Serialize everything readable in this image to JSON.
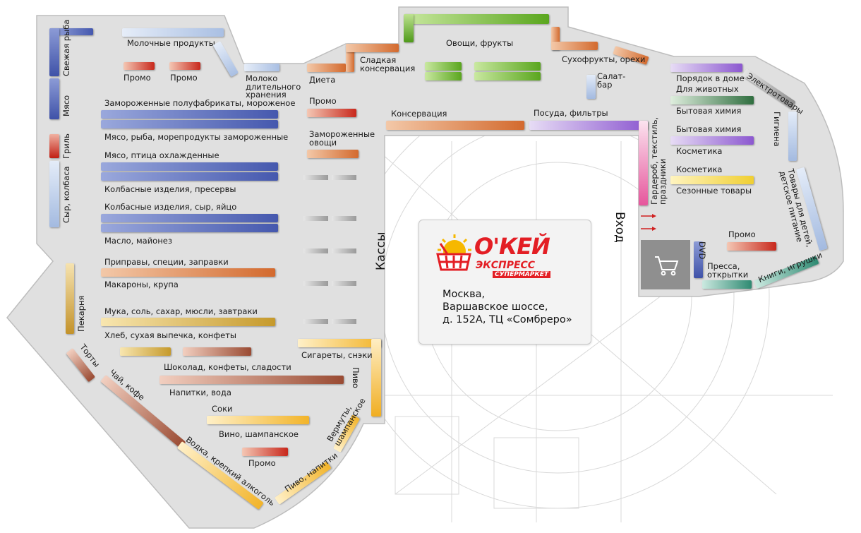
{
  "store": {
    "brand": "О'КЕЙ",
    "brand_sub": "ЭКСПРЕСС",
    "brand_sub2": "СУПЕРМАРКЕТ",
    "address_line1": "Москва,",
    "address_line2": "Варшавское шоссе,",
    "address_line3": "д. 152А, ТЦ «Сомбреро»"
  },
  "colors": {
    "floor": "#e2e2e2",
    "frozen_meat": "#4558ae",
    "bakery": "#c69a2c",
    "vegetables": "#5aa61e",
    "household": "#8c58d0",
    "alcohol": "#f2b42a",
    "promo": "#c8281c",
    "brand_red": "#e31e24",
    "brand_yellow": "#f6b800"
  },
  "zones": {
    "kassy": "Кассы",
    "vhod": "Вход"
  },
  "labels": {
    "svezhaya_ryba": "Свежая рыба",
    "myaso": "Мясо",
    "gril": "Гриль",
    "syr_kolbasa": "Сыр, колбаса",
    "molochnye": "Молочные продукты",
    "promo1": "Промо",
    "promo2": "Промо",
    "moloko": "Молоко длительного хранения",
    "zamor_polufabr": "Замороженные полуфабрикаты, мороженое",
    "myaso_ryba_zamor": "Мясо, рыба, морепродукты замороженные",
    "myaso_ptica": "Мясо, птица охлажденные",
    "kolbasnye_preservy": "Колбасные изделия, пресервы",
    "kolbasnye_syr": "Колбасные изделия, сыр, яйцо",
    "maslo": "Масло, майонез",
    "pripravy": "Приправы, специи, заправки",
    "makarony": "Макароны, крупа",
    "pekarnya": "Пекарня",
    "muka": "Мука, соль, сахар, мюсли, завтраки",
    "hleb": "Хлеб, сухая выпечка, конфеты",
    "torty": "Торты",
    "shokolad": "Шоколад, конфеты, сладости",
    "chay": "Чай, кофе",
    "napitki_voda": "Напитки, вода",
    "soki": "Соки",
    "vino": "Вино, шампанское",
    "promo_bottom": "Промо",
    "vodka": "Водка, крепкий алкоголь",
    "pivo_napitki": "Пиво, напитки",
    "vermuty": "Вермуты, шампанское",
    "sigarety": "Сигареты, снэки",
    "pivo": "Пиво",
    "dieta": "Диета",
    "sladkaya_konserv": "Сладкая консервация",
    "promo_mid": "Промо",
    "zamor_ovoshi": "Замороженные овощи",
    "ovoshi_frukty": "Овощи, фрукты",
    "suhofrukty": "Сухофрукты, орехи",
    "salat_bar": "Салат-бар",
    "konservaciya": "Консервация",
    "posuda": "Посуда, фильтры",
    "garderob": "Гардероб, текстиль, праздники",
    "poryadok": "Порядок в доме",
    "dlya_zhivotnyh": "Для животных",
    "elektrotovary": "Электротовары",
    "bytovaya1": "Бытовая химия",
    "bytovaya2": "Бытовая химия",
    "gigiena": "Гигиена",
    "kosmetika1": "Косметика",
    "kosmetika2": "Косметика",
    "sezonnye": "Сезонные товары",
    "tovary_detey": "Товары для детей, детское питание",
    "promo_right": "Промо",
    "dvd": "DVD",
    "pressa": "Пресса, открытки",
    "knigi": "Книги, игрушки"
  }
}
